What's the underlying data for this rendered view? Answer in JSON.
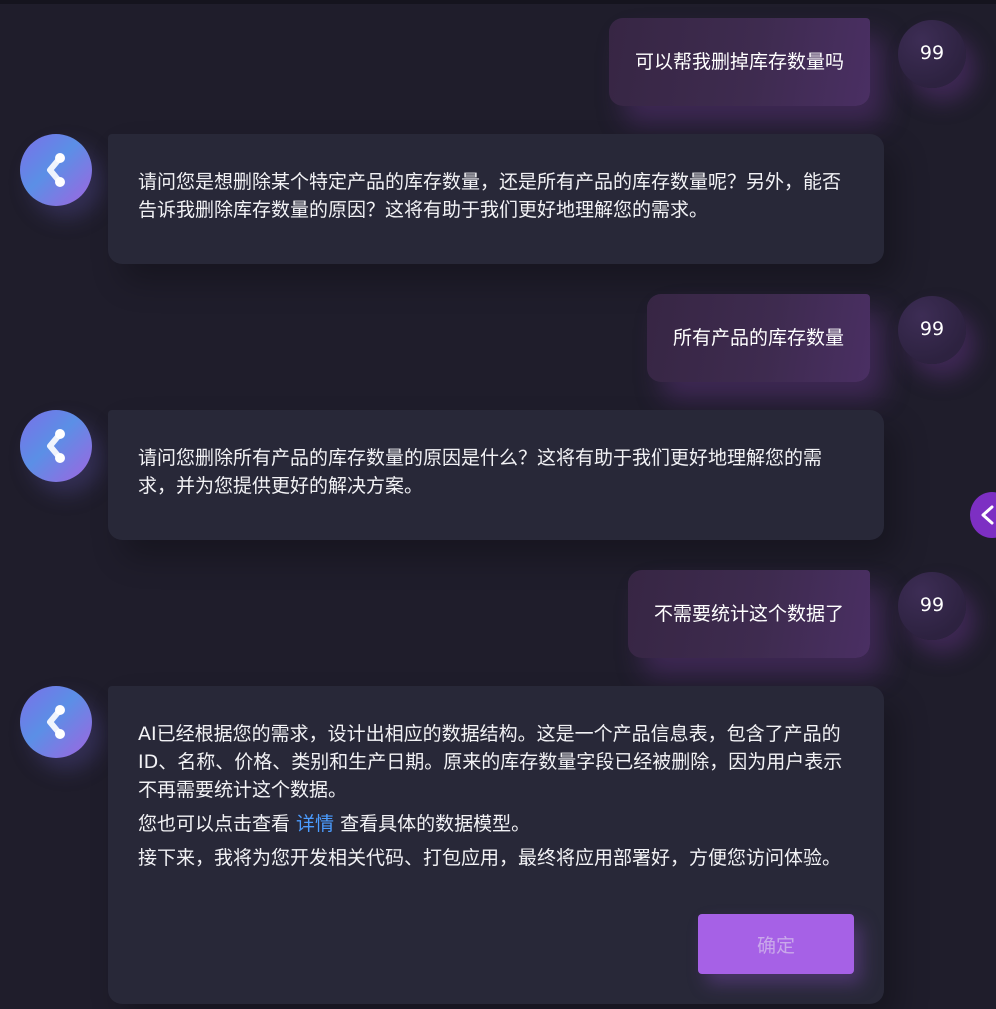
{
  "messages": [
    {
      "role": "user",
      "text": "可以帮我删掉库存数量吗",
      "avatar": "99"
    },
    {
      "role": "ai",
      "paragraphs": [
        "请问您是想删除某个特定产品的库存数量，还是所有产品的库存数量呢？另外，能否告诉我删除库存数量的原因？这将有助于我们更好地理解您的需求。"
      ]
    },
    {
      "role": "user",
      "text": "所有产品的库存数量",
      "avatar": "99"
    },
    {
      "role": "ai",
      "paragraphs": [
        "请问您删除所有产品的库存数量的原因是什么？这将有助于我们更好地理解您的需求，并为您提供更好的解决方案。"
      ]
    },
    {
      "role": "user",
      "text": "不需要统计这个数据了",
      "avatar": "99"
    },
    {
      "role": "ai",
      "paragraphs": [
        "AI已经根据您的需求，设计出相应的数据结构。这是一个产品信息表，包含了产品的ID、名称、价格、类别和生产日期。原来的库存数量字段已经被删除，因为用户表示不再需要统计这个数据。",
        "接下来，我将为您开发相关代码、打包应用，最终将应用部署好，方便您访问体验。"
      ],
      "detail_before": "您也可以点击查看 ",
      "detail_link": "详情",
      "detail_after": " 查看具体的数据模型。",
      "confirm_label": "确定"
    }
  ],
  "side_toggle": {
    "icon": "chevron-left-icon"
  },
  "colors": {
    "background": "#1f1d2b",
    "user_bubble": "#3e2b4f",
    "ai_bubble": "#282838",
    "accent": "#a661e6",
    "link": "#4b9cff"
  }
}
